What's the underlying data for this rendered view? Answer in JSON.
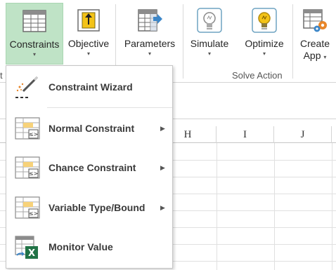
{
  "ribbon": {
    "buttons": [
      {
        "label": "Constraints",
        "icon": "grid-icon",
        "active": true
      },
      {
        "label": "Objective",
        "icon": "target-arrow-icon"
      },
      {
        "label": "Parameters",
        "icon": "parameters-icon"
      },
      {
        "label": "Simulate",
        "icon": "lightbulb-off-icon"
      },
      {
        "label": "Optimize",
        "icon": "lightbulb-on-icon"
      },
      {
        "label": "Create",
        "label2": "App",
        "icon": "create-app-icon"
      }
    ],
    "caret": "▾",
    "group_label": "Solve Action",
    "left_clip_label": "t"
  },
  "columns": [
    "H",
    "I",
    "J"
  ],
  "menu": {
    "items": [
      {
        "label": "Constraint Wizard",
        "icon": "wand-icon",
        "submenu": false
      },
      {
        "label": "Normal Constraint",
        "icon": "constraint-table-icon",
        "submenu": true
      },
      {
        "label": "Chance Constraint",
        "icon": "constraint-table-icon",
        "submenu": true
      },
      {
        "label": "Variable Type/Bound",
        "icon": "constraint-table-icon",
        "submenu": true
      },
      {
        "label": "Monitor Value",
        "icon": "excel-monitor-icon",
        "submenu": false
      }
    ],
    "submenu_arrow": "▶"
  },
  "colors": {
    "active_button": "#bfe3c6",
    "lightbulb_yellow": "#f3c317",
    "excel_green": "#217346",
    "gear_orange": "#e8862a",
    "arrow_blue": "#3c86c8"
  }
}
